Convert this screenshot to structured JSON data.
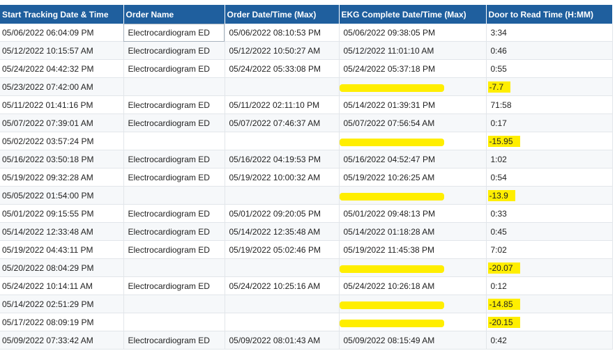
{
  "columns": [
    "Start Tracking Date & Time",
    "Order Name",
    "Order Date/Time (Max)",
    "EKG Complete Date/Time (Max)",
    "Door to Read Time (H:MM)"
  ],
  "rows": [
    {
      "start": "05/06/2022 06:04:09 PM",
      "order": "Electrocardiogram ED",
      "order_dt": "05/06/2022 08:10:53 PM",
      "ekg": "05/06/2022 09:38:05 PM",
      "door": "3:34",
      "highlight": false
    },
    {
      "start": "05/12/2022 10:15:57 AM",
      "order": "Electrocardiogram ED",
      "order_dt": "05/12/2022 10:50:27 AM",
      "ekg": "05/12/2022 11:01:10 AM",
      "door": "0:46",
      "highlight": false
    },
    {
      "start": "05/24/2022 04:42:32 PM",
      "order": "Electrocardiogram ED",
      "order_dt": "05/24/2022 05:33:08 PM",
      "ekg": "05/24/2022 05:37:18 PM",
      "door": "0:55",
      "highlight": false
    },
    {
      "start": "05/23/2022 07:42:00 AM",
      "order": "",
      "order_dt": "",
      "ekg": "",
      "door": "-7.7",
      "highlight": true
    },
    {
      "start": "05/11/2022 01:41:16 PM",
      "order": "Electrocardiogram ED",
      "order_dt": "05/11/2022 02:11:10 PM",
      "ekg": "05/14/2022 01:39:31 PM",
      "door": "71:58",
      "highlight": false
    },
    {
      "start": "05/07/2022 07:39:01 AM",
      "order": "Electrocardiogram ED",
      "order_dt": "05/07/2022 07:46:37 AM",
      "ekg": "05/07/2022 07:56:54 AM",
      "door": "0:17",
      "highlight": false
    },
    {
      "start": "05/02/2022 03:57:24 PM",
      "order": "",
      "order_dt": "",
      "ekg": "",
      "door": "-15.95",
      "highlight": true
    },
    {
      "start": "05/16/2022 03:50:18 PM",
      "order": "Electrocardiogram ED",
      "order_dt": "05/16/2022 04:19:53 PM",
      "ekg": "05/16/2022 04:52:47 PM",
      "door": "1:02",
      "highlight": false
    },
    {
      "start": "05/19/2022 09:32:28 AM",
      "order": "Electrocardiogram ED",
      "order_dt": "05/19/2022 10:00:32 AM",
      "ekg": "05/19/2022 10:26:25 AM",
      "door": "0:54",
      "highlight": false
    },
    {
      "start": "05/05/2022 01:54:00 PM",
      "order": "",
      "order_dt": "",
      "ekg": "",
      "door": "-13.9",
      "highlight": true
    },
    {
      "start": "05/01/2022 09:15:55 PM",
      "order": "Electrocardiogram ED",
      "order_dt": "05/01/2022 09:20:05 PM",
      "ekg": "05/01/2022 09:48:13 PM",
      "door": "0:33",
      "highlight": false
    },
    {
      "start": "05/14/2022 12:33:48 AM",
      "order": "Electrocardiogram ED",
      "order_dt": "05/14/2022 12:35:48 AM",
      "ekg": "05/14/2022 01:18:28 AM",
      "door": "0:45",
      "highlight": false
    },
    {
      "start": "05/19/2022 04:43:11 PM",
      "order": "Electrocardiogram ED",
      "order_dt": "05/19/2022 05:02:46 PM",
      "ekg": "05/19/2022 11:45:38 PM",
      "door": "7:02",
      "highlight": false
    },
    {
      "start": "05/20/2022 08:04:29 PM",
      "order": "",
      "order_dt": "",
      "ekg": "",
      "door": "-20.07",
      "highlight": true
    },
    {
      "start": "05/24/2022 10:14:11 AM",
      "order": "Electrocardiogram ED",
      "order_dt": "05/24/2022 10:25:16 AM",
      "ekg": "05/24/2022 10:26:18 AM",
      "door": "0:12",
      "highlight": false
    },
    {
      "start": "05/14/2022 02:51:29 PM",
      "order": "",
      "order_dt": "",
      "ekg": "",
      "door": "-14.85",
      "highlight": true
    },
    {
      "start": "05/17/2022 08:09:19 PM",
      "order": "",
      "order_dt": "",
      "ekg": "",
      "door": "-20.15",
      "highlight": true
    },
    {
      "start": "05/09/2022 07:33:42 AM",
      "order": "Electrocardiogram ED",
      "order_dt": "05/09/2022 08:01:43 AM",
      "ekg": "05/09/2022 08:15:49 AM",
      "door": "0:42",
      "highlight": false
    }
  ],
  "colors": {
    "header_bg": "#1f5f9e",
    "highlight": "#ffee00"
  }
}
